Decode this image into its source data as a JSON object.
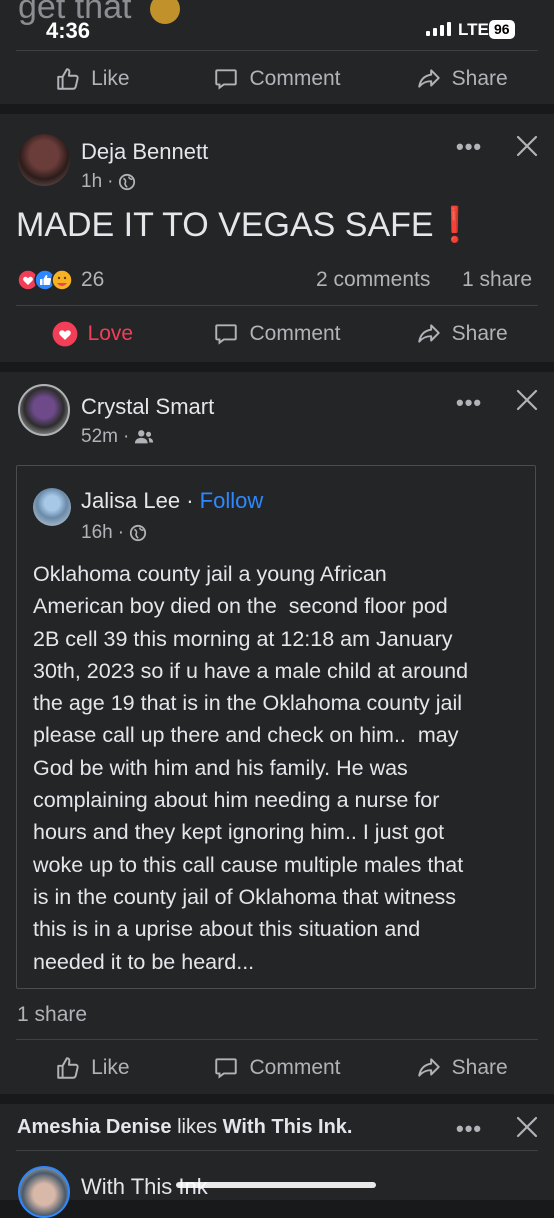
{
  "status_bar": {
    "time": "4:36",
    "network": "LTE",
    "battery": "96"
  },
  "previous_post": {
    "snippet_text": "get that",
    "actions": {
      "like": "Like",
      "comment": "Comment",
      "share": "Share"
    }
  },
  "post1": {
    "author": "Deja Bennett",
    "time": "1h",
    "text": "MADE IT TO VEGAS SAFE",
    "text_suffix": "❗",
    "reaction_count": "26",
    "comments": "2 comments",
    "shares": "1 share",
    "actions": {
      "love": "Love",
      "comment": "Comment",
      "share": "Share"
    }
  },
  "post2": {
    "author": "Crystal Smart",
    "time": "52m",
    "shared": {
      "author": "Jalisa Lee",
      "separator": "·",
      "follow": "Follow",
      "time": "16h",
      "lines": [
        "Oklahoma county jail a young African",
        "American boy died on the  second floor pod",
        "2B cell 39 this morning at 12:18 am January",
        "30th, 2023 so if u have a male child at around",
        "the age 19 that is in the Oklahoma county jail",
        "please call up there and check on him..  may",
        "God be with him and his family. He was",
        "complaining about him needing a nurse for",
        "hours and they kept ignoring him.. I just got",
        "woke up to this call cause multiple males that",
        "is in the county jail of Oklahoma that witness",
        "this is in a uprise about this situation and",
        "needed it to be heard..."
      ]
    },
    "shares": "1 share",
    "actions": {
      "like": "Like",
      "comment": "Comment",
      "share": "Share"
    }
  },
  "post3": {
    "activity_user": "Ameshia Denise",
    "activity_verb": "likes",
    "activity_page": "With This Ink.",
    "author": "With This Ink"
  },
  "colors": {
    "background": "#18191a",
    "card": "#242526",
    "love": "#f33e58",
    "link": "#2d88ff",
    "alert": "#e41e3f"
  }
}
